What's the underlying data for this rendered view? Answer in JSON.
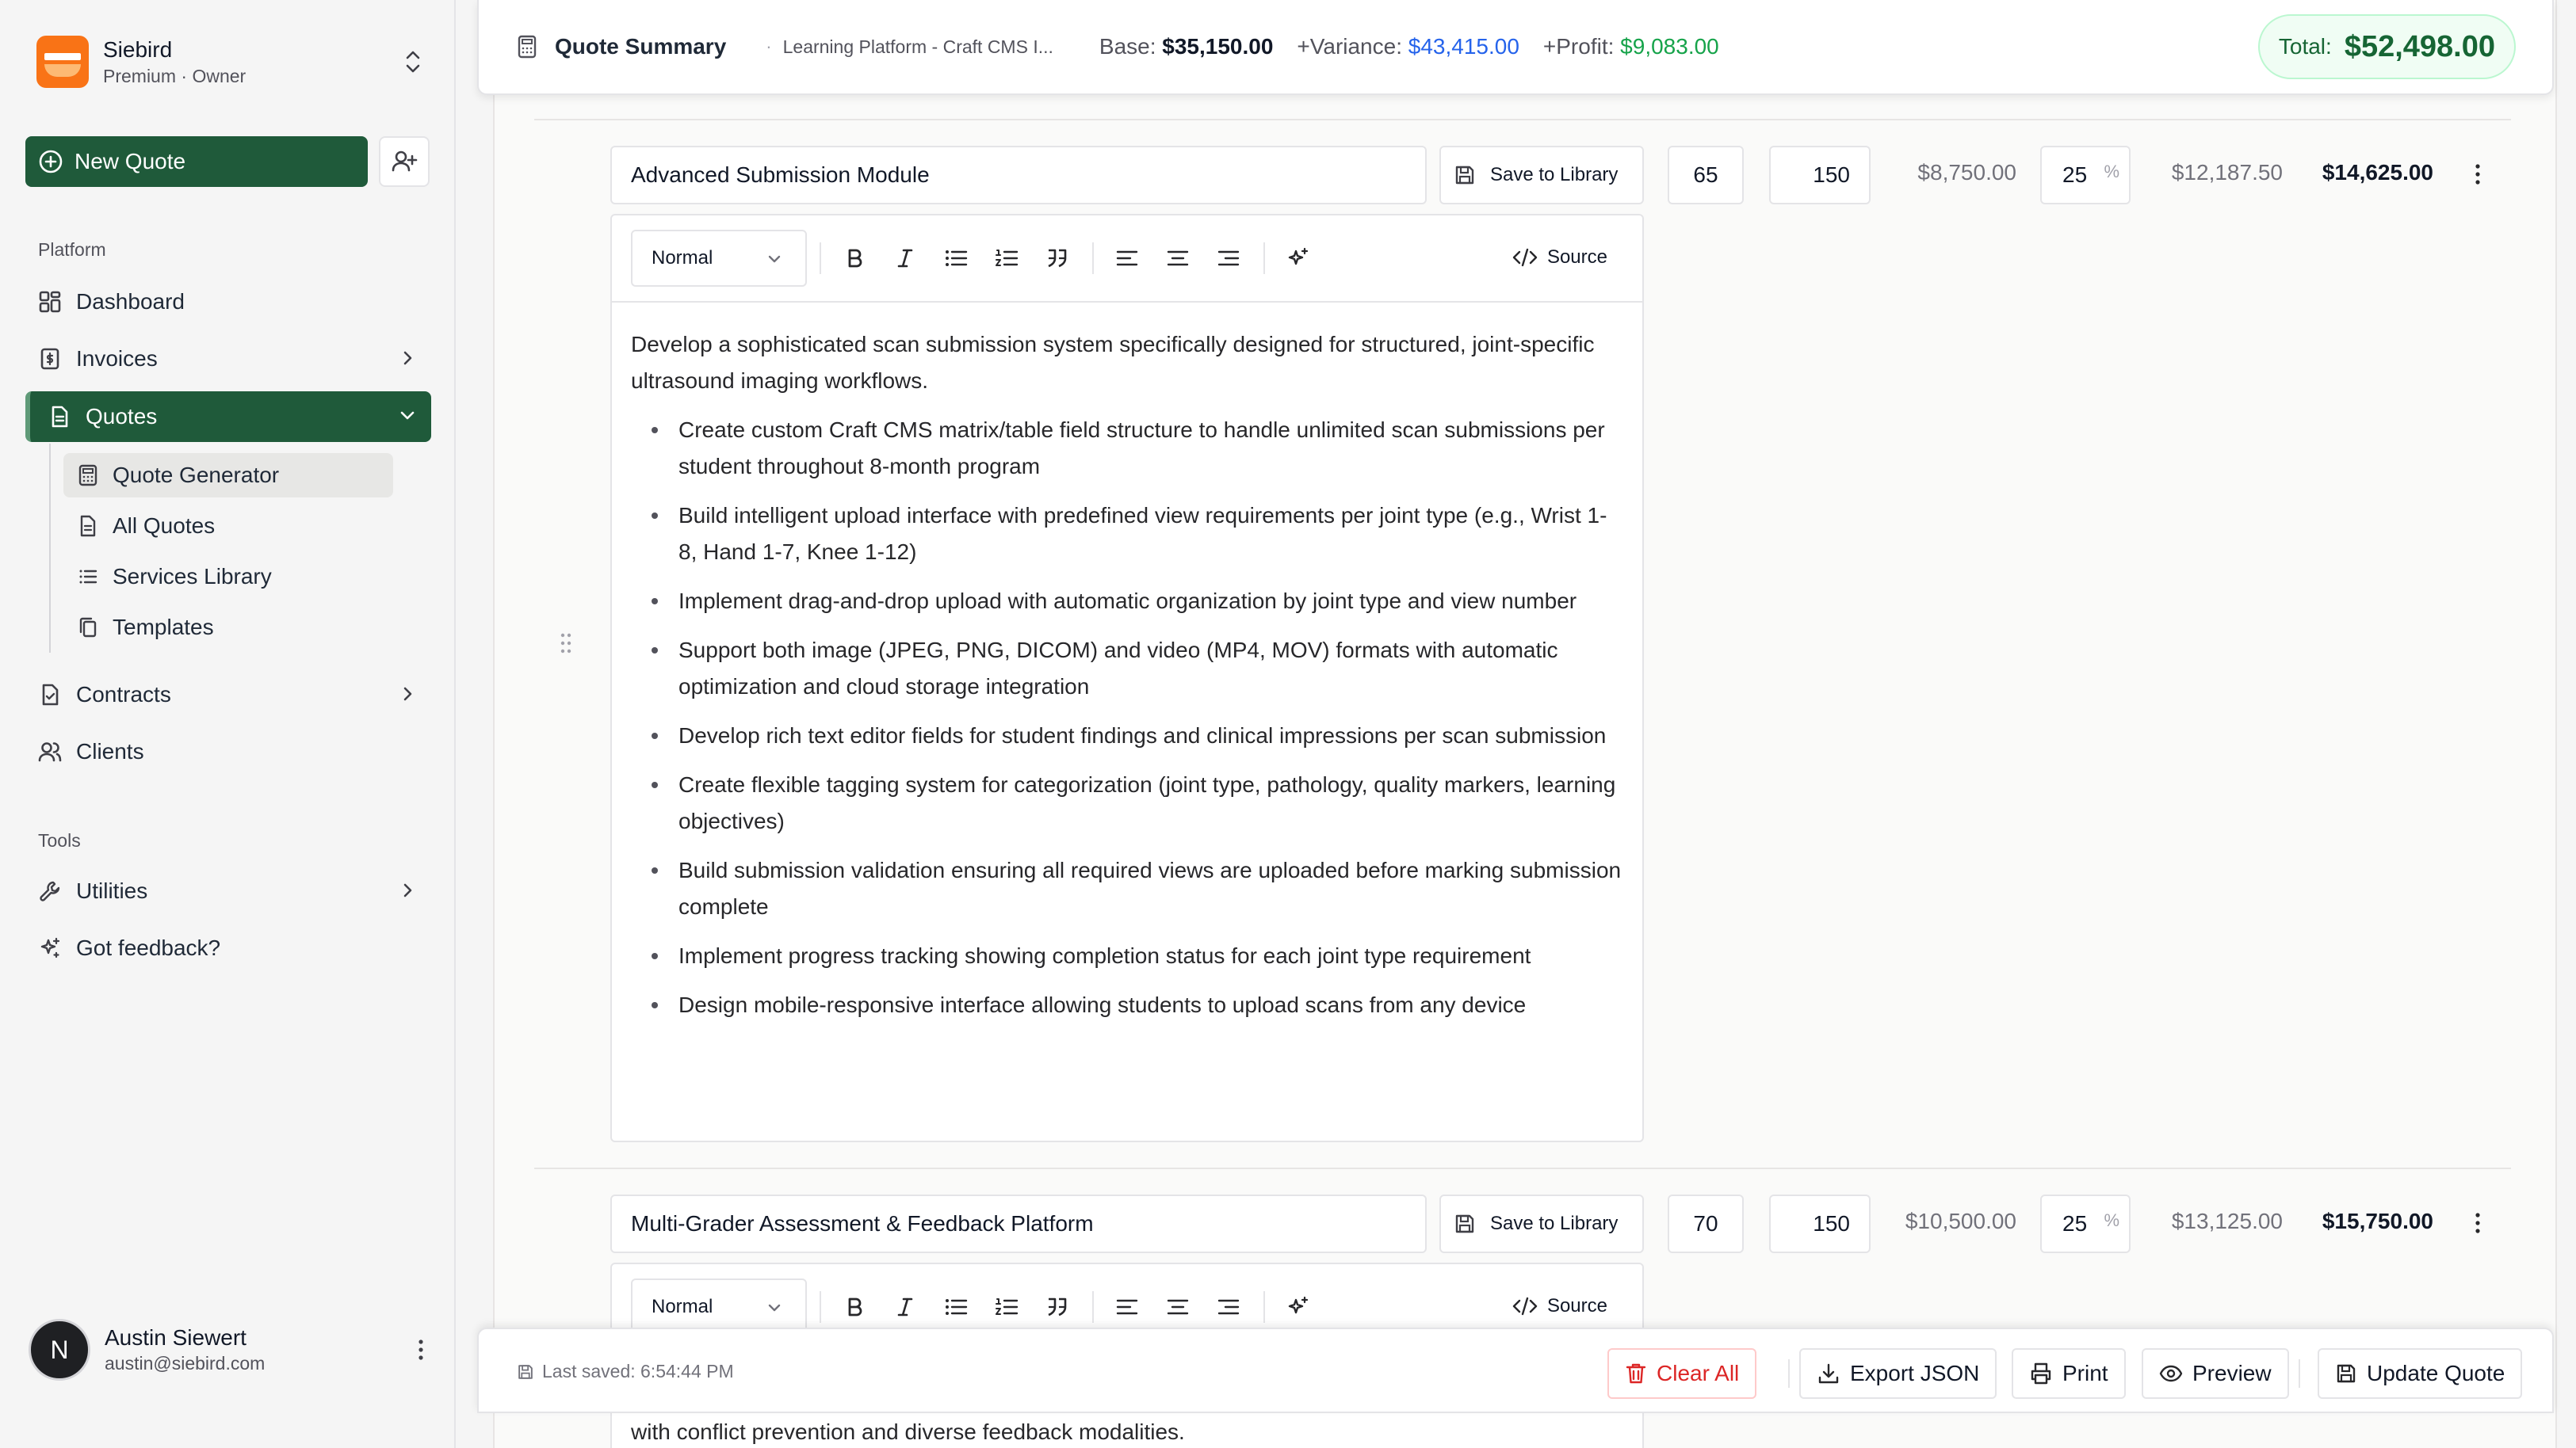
{
  "sidebar": {
    "org": {
      "name": "Siebird",
      "subtitle": "Premium · Owner",
      "logo_icon": "siebird-logo"
    },
    "new_quote_label": "New Quote",
    "add_client_icon": "user-plus-icon",
    "sections": {
      "platform": "Platform",
      "tools": "Tools"
    },
    "nav": {
      "dashboard": "Dashboard",
      "invoices": "Invoices",
      "quotes": "Quotes",
      "contracts": "Contracts",
      "clients": "Clients",
      "utilities": "Utilities",
      "feedback": "Got feedback?"
    },
    "quotes_sub": {
      "generator": "Quote Generator",
      "all": "All Quotes",
      "services": "Services Library",
      "templates": "Templates"
    },
    "user": {
      "initial": "N",
      "name": "Austin Siewert",
      "email": "austin@siebird.com"
    }
  },
  "topbar": {
    "title": "Quote Summary",
    "separator": "·",
    "project": "Learning Platform - Craft CMS I...",
    "base_label": "Base:",
    "base_value": "$35,150.00",
    "variance_label": "+Variance:",
    "variance_value": "$43,415.00",
    "profit_label": "+Profit:",
    "profit_value": "$9,083.00",
    "total_label": "Total:",
    "total_value": "$52,498.00"
  },
  "line_items": [
    {
      "title": "Advanced Submission Module",
      "save_label": "Save to Library",
      "hours": "65",
      "rate": "150",
      "base": "$8,750.00",
      "variance_pct": "25",
      "pct_symbol": "%",
      "subtotal": "$12,187.50",
      "total": "$14,625.00",
      "editor": {
        "format": "Normal",
        "source_label": "Source",
        "intro": "Develop a sophisticated scan submission system specifically designed for structured, joint-specific ultrasound imaging workflows.",
        "bullets": [
          "Create custom Craft CMS matrix/table field structure to handle unlimited scan submissions per student throughout 8-month program",
          "Build intelligent upload interface with predefined view requirements per joint type (e.g., Wrist 1-8, Hand 1-7, Knee 1-12)",
          "Implement drag-and-drop upload with automatic organization by joint type and view number",
          "Support both image (JPEG, PNG, DICOM) and video (MP4, MOV) formats with automatic optimization and cloud storage integration",
          "Develop rich text editor fields for student findings and clinical impressions per scan submission",
          "Create flexible tagging system for categorization (joint type, pathology, quality markers, learning objectives)",
          "Build submission validation ensuring all required views are uploaded before marking submission complete",
          "Implement progress tracking showing completion status for each joint type requirement",
          "Design mobile-responsive interface allowing students to upload scans from any device"
        ]
      }
    },
    {
      "title": "Multi-Grader Assessment & Feedback Platform",
      "save_label": "Save to Library",
      "hours": "70",
      "rate": "150",
      "base": "$10,500.00",
      "variance_pct": "25",
      "pct_symbol": "%",
      "subtotal": "$13,125.00",
      "total": "$15,750.00",
      "editor": {
        "format": "Normal",
        "source_label": "Source",
        "peek_text": "with conflict prevention and diverse feedback modalities."
      }
    }
  ],
  "bottombar": {
    "last_saved": "Last saved: 6:54:44 PM",
    "clear_all": "Clear All",
    "export_json": "Export JSON",
    "print": "Print",
    "preview": "Preview",
    "update_quote": "Update Quote"
  },
  "colors": {
    "primary": "#1f5a3a",
    "variance": "#2563eb",
    "profit": "#16a34a",
    "danger": "#dc2626",
    "brand_orange": "#f97316"
  }
}
